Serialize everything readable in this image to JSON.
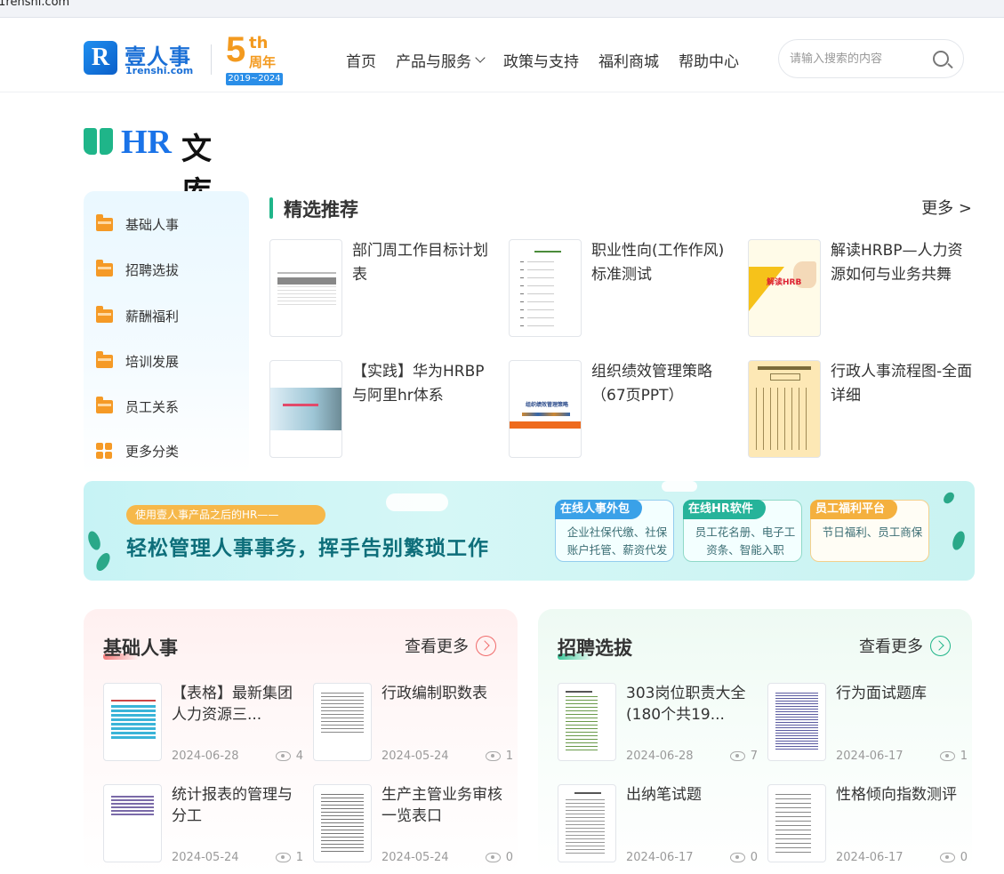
{
  "browser": {
    "url_fragment": ".1renshi.com"
  },
  "header": {
    "logo_letter": "R",
    "logo_cn": "壹人事",
    "logo_en": "1renshi.com",
    "anniversary": {
      "number": "5",
      "suffix": "th",
      "cn": "周年",
      "years": "2019~2024"
    },
    "nav": [
      {
        "label": "首页"
      },
      {
        "label": "产品与服务"
      },
      {
        "label": "政策与支持"
      },
      {
        "label": "福利商城"
      },
      {
        "label": "帮助中心"
      }
    ],
    "search_placeholder": "请输入搜索的内容"
  },
  "library": {
    "title_hr": "HR",
    "title_cn": "文库"
  },
  "sidebar": {
    "items": [
      {
        "label": "基础人事"
      },
      {
        "label": "招聘选拔"
      },
      {
        "label": "薪酬福利"
      },
      {
        "label": "培训发展"
      },
      {
        "label": "员工关系"
      },
      {
        "label": "更多分类"
      }
    ]
  },
  "featured": {
    "title": "精选推荐",
    "more": "更多 >",
    "docs": [
      {
        "title": "部门周工作目标计划表"
      },
      {
        "title": "职业性向(工作作风)标准测试"
      },
      {
        "title": "解读HRBP—人力资源如何与业务共舞"
      },
      {
        "title": "【实践】华为HRBP与阿里hr体系"
      },
      {
        "title": "组织绩效管理策略（67页PPT）"
      },
      {
        "title": "行政人事流程图-全面详细"
      }
    ],
    "thumb_text": {
      "hrbp": "解读HRB",
      "ppt": "组织绩效管理策略"
    }
  },
  "banner": {
    "tag": "使用壹人事产品之后的HR——",
    "headline": "轻松管理人事事务，挥手告别繁琐工作",
    "cards": [
      {
        "label": "在线人事外包",
        "text": "企业社保代缴、社保账户托管、薪资代发",
        "color": "#3aa1e8"
      },
      {
        "label": "在线HR软件",
        "text": "员工花名册、电子工资条、智能入职",
        "color": "#26b39a"
      },
      {
        "label": "员工福利平台",
        "text": "节日福利、员工商保",
        "color": "#f4b03e"
      }
    ]
  },
  "panels": [
    {
      "title": "基础人事",
      "more": "查看更多",
      "accent": "#f06b6b",
      "docs": [
        {
          "title": "【表格】最新集团人力资源三...",
          "date": "2024-06-28",
          "views": "4"
        },
        {
          "title": "行政编制职数表",
          "date": "2024-05-24",
          "views": "1"
        },
        {
          "title": "统计报表的管理与分工",
          "date": "2024-05-24",
          "views": "1"
        },
        {
          "title": "生产主管业务审核一览表口",
          "date": "2024-05-24",
          "views": "0"
        }
      ]
    },
    {
      "title": "招聘选拔",
      "more": "查看更多",
      "accent": "#1fb589",
      "docs": [
        {
          "title": "303岗位职责大全(180个共19...",
          "date": "2024-06-28",
          "views": "7"
        },
        {
          "title": "行为面试题库",
          "date": "2024-06-17",
          "views": "1"
        },
        {
          "title": "出纳笔试题",
          "date": "2024-06-17",
          "views": "0"
        },
        {
          "title": "性格倾向指数测评",
          "date": "2024-06-17",
          "views": "0"
        }
      ]
    }
  ]
}
